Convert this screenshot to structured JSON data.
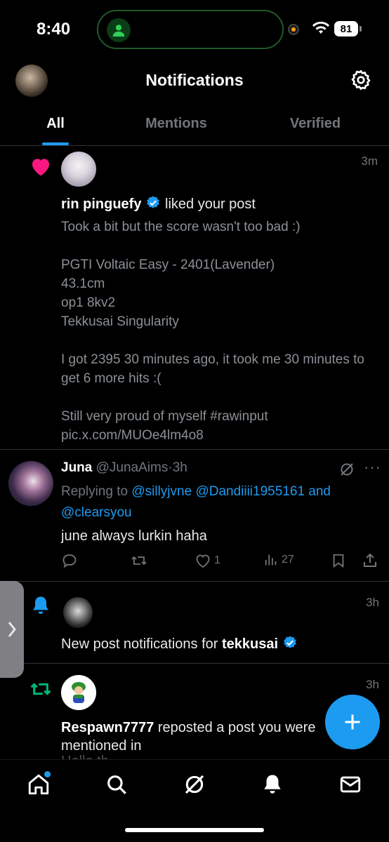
{
  "status_bar": {
    "time": "8:40",
    "battery": "81"
  },
  "header": {
    "title": "Notifications"
  },
  "tabs": [
    {
      "label": "All",
      "active": true
    },
    {
      "label": "Mentions",
      "active": false
    },
    {
      "label": "Verified",
      "active": false
    }
  ],
  "notifications": {
    "like": {
      "user": "rin pinguefy",
      "action": "liked your post",
      "time": "3m",
      "body": "Took a bit but the score wasn't too bad :)\n\nPGTI Voltaic Easy - 2401(Lavender)\n43.1cm\nop1 8kv2\nTekkusai Singularity\n\nI got 2395 30 minutes ago, it took me 30 minutes to get 6 more hits :(\n\nStill very proud of myself #rawinput pic.x.com/MUOe4lm4o8"
    },
    "reply": {
      "name": "Juna",
      "handle": "@JunaAims",
      "separator": "·",
      "time": "3h",
      "replying_prefix": "Replying to",
      "mention1": "@sillyjvne",
      "mention2": "@Dandiiii1955161",
      "and": "and",
      "mention3": "@clearsyou",
      "text": "june always lurkin haha",
      "likes": "1",
      "views": "27"
    },
    "new_post": {
      "prefix": "New post notifications for",
      "user": "tekkusai",
      "time": "3h"
    },
    "repost": {
      "user": "Respawn7777",
      "action": "reposted a post you were mentioned in",
      "time": "3h",
      "cut_text": "Hello th..."
    }
  },
  "colors": {
    "accent": "#1d9bf0",
    "like": "#f91880",
    "repost": "#00ba7c",
    "background": "#000000"
  }
}
